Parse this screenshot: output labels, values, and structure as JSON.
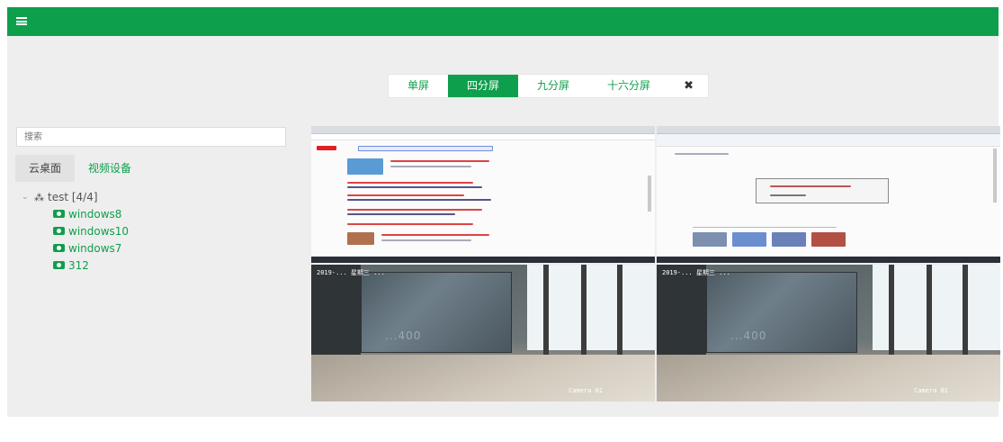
{
  "header": {
    "menu_icon": "hamburger-menu-icon"
  },
  "split_modes": {
    "single": "单屏",
    "quad": "四分屏",
    "nine": "九分屏",
    "sixteen": "十六分屏",
    "fullscreen_icon": "✖",
    "active": "四分屏"
  },
  "sidebar": {
    "search_placeholder": "搜索",
    "tabs": [
      {
        "label": "云桌面",
        "active": true
      },
      {
        "label": "视频设备",
        "active": false
      }
    ],
    "tree": {
      "root_label": "test [4/4]",
      "items": [
        "windows8",
        "windows10",
        "windows7",
        "312"
      ]
    }
  },
  "screens": [
    {
      "type": "desktop-browser"
    },
    {
      "type": "desktop-dialog"
    },
    {
      "type": "camera",
      "osd_top": "2019-...  星期三  ...",
      "osd_cam": "Camera 01",
      "case_label": "...400",
      "selected": true
    },
    {
      "type": "camera",
      "osd_top": "2019-...  星期三  ...",
      "osd_cam": "Camera 01",
      "case_label": "...400",
      "selected": false
    }
  ],
  "colors": {
    "accent": "#0e9f4c",
    "selected_border": "#e0463e"
  }
}
